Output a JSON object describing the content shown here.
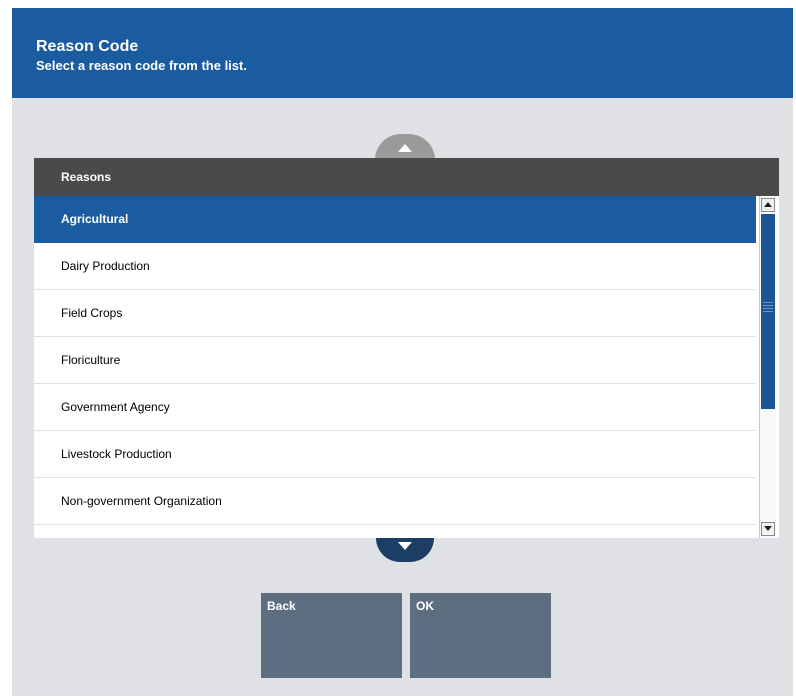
{
  "header": {
    "title": "Reason Code",
    "subtitle": "Select a reason code from the list."
  },
  "list": {
    "header": "Reasons",
    "items": [
      "Agricultural",
      "Dairy Production",
      "Field Crops",
      "Floriculture",
      "Government Agency",
      "Livestock Production",
      "Non-government Organization",
      ""
    ],
    "selected_item": "Agricultural"
  },
  "buttons": {
    "back_label": "Back",
    "ok_label": "OK"
  },
  "icons": {
    "scroll_up": "up-arrow-icon",
    "scroll_down": "down-arrow-icon"
  },
  "colors": {
    "accent": "#1b5b9f",
    "list_header_bg": "#4a4a4a",
    "button_bg": "#5d6e80",
    "page_bg": "#dfe1e4"
  }
}
